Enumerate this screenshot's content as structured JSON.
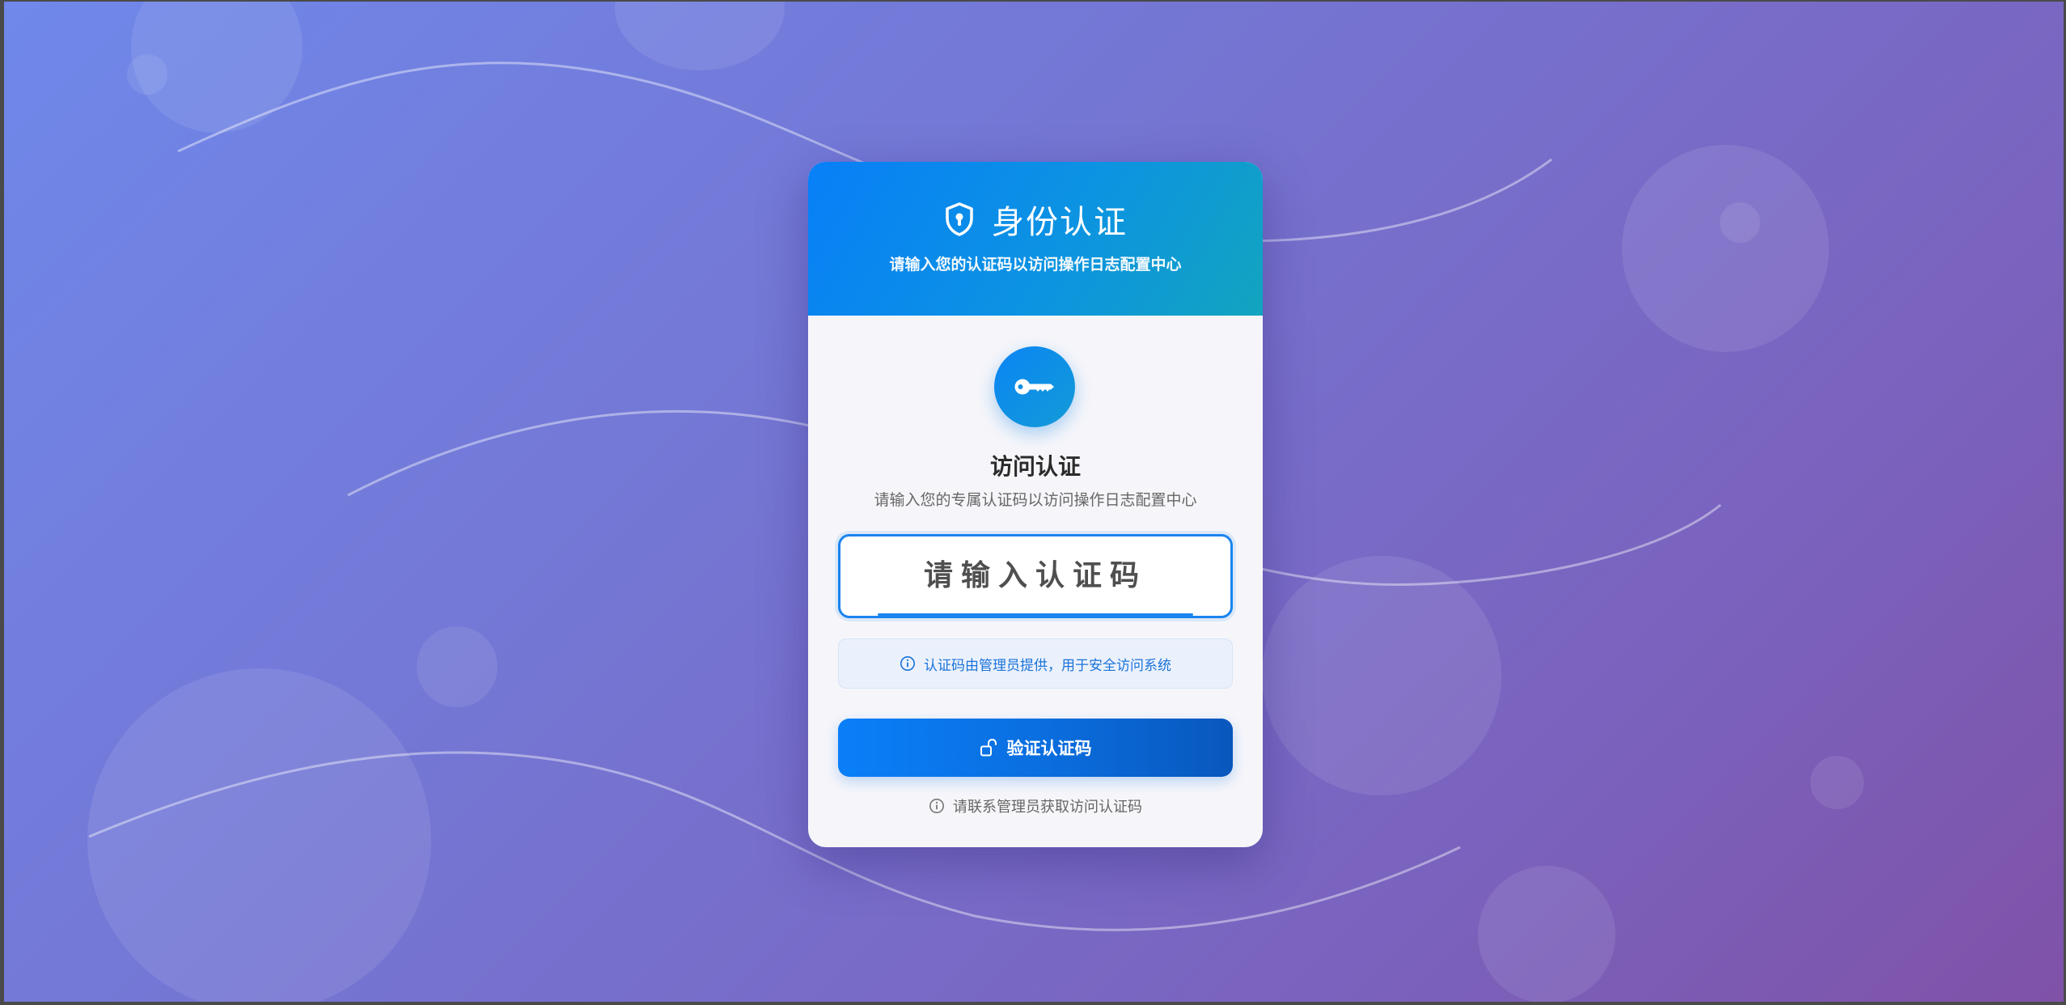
{
  "header": {
    "title": "身份认证",
    "subtitle": "请输入您的认证码以访问操作日志配置中心"
  },
  "auth": {
    "title": "访问认证",
    "description": "请输入您的专属认证码以访问操作日志配置中心",
    "code_input": {
      "value": "",
      "placeholder": "请输入认证码"
    },
    "info_text": "认证码由管理员提供，用于安全访问系统",
    "verify_label": "验证认证码",
    "contact_note": "请联系管理员获取访问认证码"
  },
  "icons": {
    "header": "shield-lock-icon",
    "hero": "key-icon",
    "info": "info-circle-icon",
    "button": "unlock-icon",
    "note": "info-circle-icon"
  },
  "colors": {
    "primary": "#0a7ff8",
    "header_end": "#12a4bf",
    "info_text": "#1a73d9",
    "card_bg": "#f6f6fa",
    "page_bg_start": "#6f88ea",
    "page_bg_end": "#7f52a8"
  }
}
